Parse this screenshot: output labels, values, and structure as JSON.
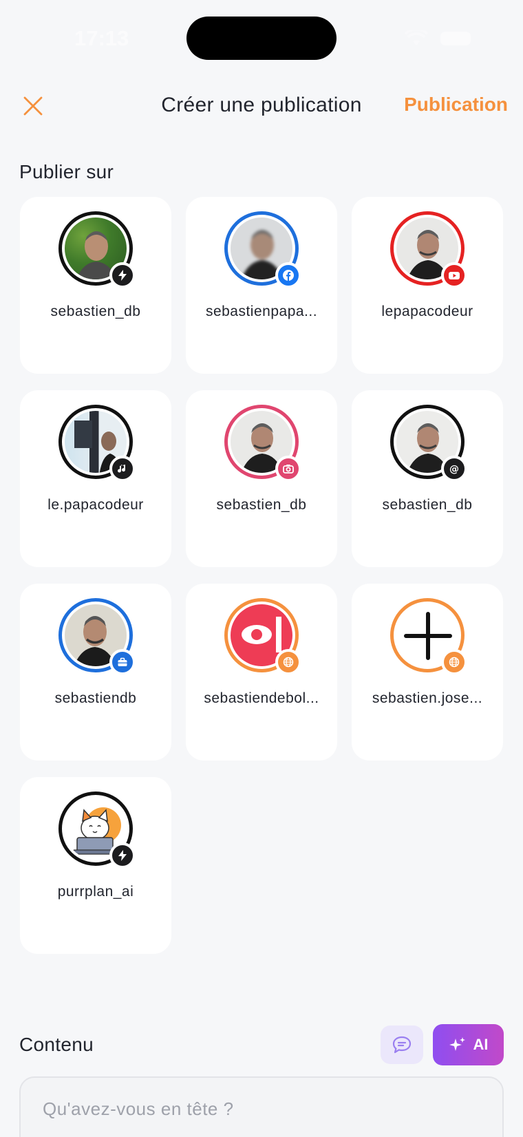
{
  "status_bar": {
    "time": "17:13"
  },
  "header": {
    "close_icon": "close-icon",
    "title": "Créer une publication",
    "publish_label": "Publication",
    "accent_color": "#f5913e"
  },
  "publish_section": {
    "label": "Publier sur"
  },
  "accounts": [
    {
      "name": "sebastien_db",
      "ring_color": "#111111",
      "badge": "bolt-icon",
      "badge_color": "#1c1c1e",
      "avatar": "photo-green-background"
    },
    {
      "name": "sebastienpapa...",
      "ring_color": "#1e6fdc",
      "badge": "facebook-icon",
      "badge_color": "#1877f2",
      "avatar": "photo-blurred"
    },
    {
      "name": "lepapacodeur",
      "ring_color": "#e52222",
      "badge": "youtube-icon",
      "badge_color": "#e52222",
      "avatar": "photo"
    },
    {
      "name": "le.papacodeur",
      "ring_color": "#111111",
      "badge": "tiktok-music-icon",
      "badge_color": "#1c1c1e",
      "avatar": "photo-desk"
    },
    {
      "name": "sebastien_db",
      "ring_color": "#e0466f",
      "badge": "instagram-camera-icon",
      "badge_color": "#e0466f",
      "avatar": "photo"
    },
    {
      "name": "sebastien_db",
      "ring_color": "#111111",
      "badge": "threads-icon",
      "badge_color": "#1c1c1e",
      "avatar": "photo"
    },
    {
      "name": "sebastiendb",
      "ring_color": "#1e6fdc",
      "badge": "linkedin-briefcase-icon",
      "badge_color": "#1e6fdc",
      "avatar": "photo"
    },
    {
      "name": "sebastiendebol...",
      "ring_color": "#f5913e",
      "badge": "globe-icon",
      "badge_color": "#f5913e",
      "avatar": "red-eye-logo"
    },
    {
      "name": "sebastien.jose...",
      "ring_color": "#f5913e",
      "badge": "globe-icon",
      "badge_color": "#f5913e",
      "avatar": "plus-icon"
    },
    {
      "name": "purrplan_ai",
      "ring_color": "#111111",
      "badge": "bolt-icon",
      "badge_color": "#1c1c1e",
      "avatar": "cat-laptop-logo"
    }
  ],
  "content_section": {
    "label": "Contenu",
    "chat_icon": "chat-bubble-icon",
    "ai_label": "AI",
    "ai_icon": "sparkle-icon",
    "placeholder": "Qu'avez-vous en tête ?"
  }
}
